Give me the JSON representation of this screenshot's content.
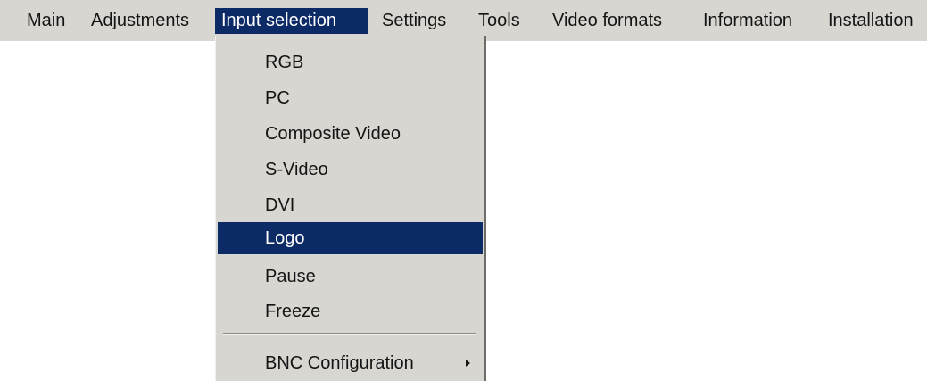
{
  "menubar": {
    "items": [
      {
        "label": "Main"
      },
      {
        "label": "Adjustments"
      },
      {
        "label": "Input selection",
        "active": true
      },
      {
        "label": "Settings"
      },
      {
        "label": "Tools"
      },
      {
        "label": "Video formats"
      },
      {
        "label": "Information"
      },
      {
        "label": "Installation"
      }
    ]
  },
  "dropdown": {
    "items": [
      {
        "label": "RGB"
      },
      {
        "label": "PC"
      },
      {
        "label": "Composite Video"
      },
      {
        "label": "S-Video"
      },
      {
        "label": "DVI"
      },
      {
        "label": "Logo",
        "selected": true
      },
      {
        "label": "Pause"
      },
      {
        "label": "Freeze"
      },
      {
        "label": "BNC Configuration",
        "submenu": true,
        "icon": "triangle-right-icon"
      }
    ]
  },
  "colors": {
    "menu_background": "#d8d6d1",
    "highlight": "#0c2a66",
    "highlight_text": "#ffffff",
    "text": "#141414"
  }
}
